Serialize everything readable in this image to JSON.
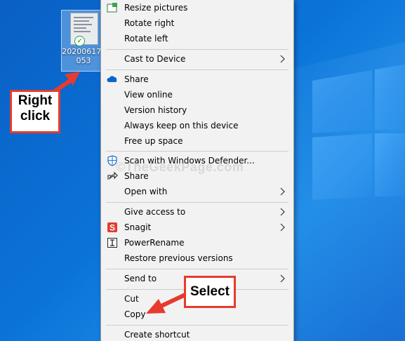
{
  "desktop": {
    "file_icon": {
      "label_line1": "20200617_",
      "label_line2": "053",
      "icon": "image-file-icon",
      "status_icon": "sync-check-icon"
    }
  },
  "context_menu": {
    "items": [
      {
        "id": "resize",
        "label": "Resize pictures",
        "icon": "resize-pictures-icon"
      },
      {
        "id": "rotate-right",
        "label": "Rotate right"
      },
      {
        "id": "rotate-left",
        "label": "Rotate left"
      },
      {
        "id": "cast",
        "label": "Cast to Device",
        "submenu": true
      },
      {
        "id": "share-onedrive",
        "label": "Share",
        "icon": "onedrive-cloud-icon"
      },
      {
        "id": "view-online",
        "label": "View online"
      },
      {
        "id": "version-history",
        "label": "Version history"
      },
      {
        "id": "keep-on-device",
        "label": "Always keep on this device"
      },
      {
        "id": "free-up",
        "label": "Free up space"
      },
      {
        "id": "defender",
        "label": "Scan with Windows Defender...",
        "icon": "windows-defender-icon"
      },
      {
        "id": "share",
        "label": "Share",
        "icon": "share-icon"
      },
      {
        "id": "open-with",
        "label": "Open with",
        "submenu": true
      },
      {
        "id": "give-access",
        "label": "Give access to",
        "submenu": true
      },
      {
        "id": "snagit",
        "label": "Snagit",
        "icon": "snagit-icon",
        "submenu": true
      },
      {
        "id": "powerrename",
        "label": "PowerRename",
        "icon": "powerrename-icon"
      },
      {
        "id": "restore",
        "label": "Restore previous versions"
      },
      {
        "id": "send-to",
        "label": "Send to",
        "submenu": true
      },
      {
        "id": "cut",
        "label": "Cut"
      },
      {
        "id": "copy",
        "label": "Copy"
      },
      {
        "id": "create-shortcut",
        "label": "Create shortcut"
      }
    ]
  },
  "annotations": {
    "right_click_line1": "Right",
    "right_click_line2": "click",
    "select": "Select",
    "accent_color": "#e63b2e"
  },
  "watermark": "©TheGeekPage.com"
}
